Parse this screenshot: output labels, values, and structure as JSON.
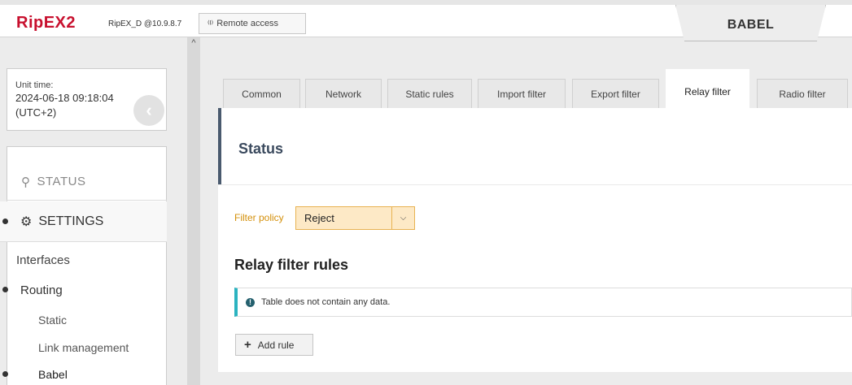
{
  "header": {
    "logo": "RipEX2",
    "device": "RipEX_D @10.9.8.7",
    "remote_label": "Remote access",
    "remote_icon": "antenna-icon",
    "babel_label": "BABEL"
  },
  "sidebar": {
    "unit_time_label": "Unit time:",
    "unit_time_value": "2024-06-18 09:18:04",
    "unit_time_tz": "(UTC+2)",
    "status_label": "STATUS",
    "settings_label": "SETTINGS",
    "items": {
      "interfaces": "Interfaces",
      "routing": "Routing",
      "static": "Static",
      "link_management": "Link management",
      "babel": "Babel"
    }
  },
  "tabs": [
    {
      "label": "Common"
    },
    {
      "label": "Network"
    },
    {
      "label": "Static rules"
    },
    {
      "label": "Import filter"
    },
    {
      "label": "Export filter"
    },
    {
      "label": "Relay filter",
      "active": true
    },
    {
      "label": "Radio filter"
    }
  ],
  "main": {
    "status_title": "Status",
    "filter_policy_label": "Filter policy",
    "filter_policy_value": "Reject",
    "rules_title": "Relay filter rules",
    "empty_message": "Table does not contain any data.",
    "add_rule_label": "Add rule"
  },
  "colors": {
    "brand": "#c8102e",
    "accent_orange": "#d4900b",
    "info_teal": "#2bb3c0",
    "status_stripe": "#4a5a6e"
  }
}
